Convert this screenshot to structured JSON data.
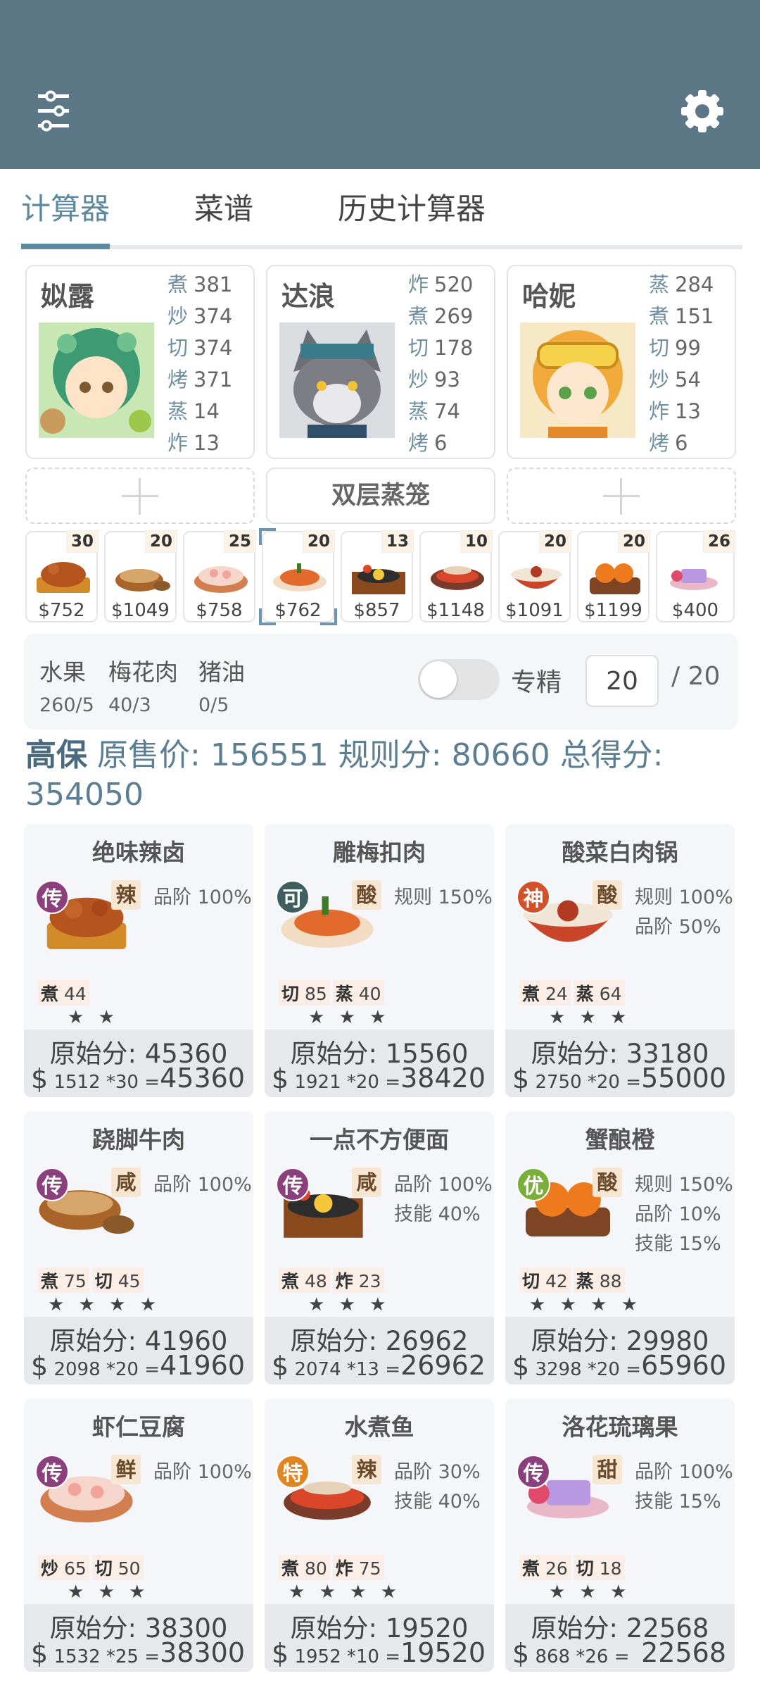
{
  "colors": {
    "header": "#5c7785",
    "accent": "#5c8aa0",
    "badge_chuan": "#8b3f7d",
    "badge_ke": "#3f5f5f",
    "badge_shen": "#d2502a",
    "badge_you": "#7aae3a",
    "badge_te": "#e08520"
  },
  "tabs": [
    "计算器",
    "菜谱",
    "历史计算器"
  ],
  "chefs": [
    {
      "name": "姒露",
      "stats": [
        {
          "k": "煮",
          "v": "381"
        },
        {
          "k": "炒",
          "v": "374"
        },
        {
          "k": "切",
          "v": "374"
        },
        {
          "k": "烤",
          "v": "371"
        },
        {
          "k": "蒸",
          "v": "14"
        },
        {
          "k": "炸",
          "v": "13"
        }
      ]
    },
    {
      "name": "达浪",
      "stats": [
        {
          "k": "炸",
          "v": "520"
        },
        {
          "k": "煮",
          "v": "269"
        },
        {
          "k": "切",
          "v": "178"
        },
        {
          "k": "炒",
          "v": "93"
        },
        {
          "k": "蒸",
          "v": "74"
        },
        {
          "k": "烤",
          "v": "6"
        }
      ]
    },
    {
      "name": "哈妮",
      "stats": [
        {
          "k": "蒸",
          "v": "284"
        },
        {
          "k": "煮",
          "v": "151"
        },
        {
          "k": "切",
          "v": "99"
        },
        {
          "k": "炒",
          "v": "54"
        },
        {
          "k": "炸",
          "v": "13"
        },
        {
          "k": "烤",
          "v": "6"
        }
      ]
    }
  ],
  "equip_slot": "双层蒸笼",
  "dishes": [
    {
      "qty": "30",
      "price": "$752"
    },
    {
      "qty": "20",
      "price": "$1049"
    },
    {
      "qty": "25",
      "price": "$758"
    },
    {
      "qty": "20",
      "price": "$762"
    },
    {
      "qty": "13",
      "price": "$857"
    },
    {
      "qty": "10",
      "price": "$1148"
    },
    {
      "qty": "20",
      "price": "$1091"
    },
    {
      "qty": "20",
      "price": "$1199"
    },
    {
      "qty": "26",
      "price": "$400"
    }
  ],
  "ingredients": [
    {
      "name": "水果",
      "count": "260/5"
    },
    {
      "name": "梅花肉",
      "count": "40/3"
    },
    {
      "name": "猪油",
      "count": "0/5"
    }
  ],
  "specialize": {
    "label": "专精",
    "value": "20",
    "max": "/ 20",
    "on": false
  },
  "summary": {
    "name": "高保",
    "orig_label": "原售价:",
    "orig": "156551",
    "rule_label": "规则分:",
    "rule": "80660",
    "total_label": "总得分:",
    "total": "354050"
  },
  "recipes": [
    {
      "title": "绝味辣卤",
      "badge": "传",
      "flavor": "辣",
      "tags": [
        "品阶 100%"
      ],
      "skills": [
        {
          "k": "煮",
          "v": "44"
        }
      ],
      "stars": "★ ★",
      "orig": "原始分: 45360",
      "price": "1512",
      "mult": "*30 =",
      "total": "45360"
    },
    {
      "title": "雕梅扣肉",
      "badge": "可",
      "flavor": "酸",
      "tags": [
        "规则 150%"
      ],
      "skills": [
        {
          "k": "切",
          "v": "85"
        },
        {
          "k": "蒸",
          "v": "40"
        }
      ],
      "stars": "★ ★ ★",
      "orig": "原始分: 15560",
      "price": "1921",
      "mult": "*20 =",
      "total": "38420"
    },
    {
      "title": "酸菜白肉锅",
      "badge": "神",
      "flavor": "酸",
      "tags": [
        "规则 100%",
        "品阶 50%"
      ],
      "skills": [
        {
          "k": "煮",
          "v": "24"
        },
        {
          "k": "蒸",
          "v": "64"
        }
      ],
      "stars": "★ ★ ★",
      "orig": "原始分: 33180",
      "price": "2750",
      "mult": "*20 =",
      "total": "55000"
    },
    {
      "title": "跷脚牛肉",
      "badge": "传",
      "flavor": "咸",
      "tags": [
        "品阶 100%"
      ],
      "skills": [
        {
          "k": "煮",
          "v": "75"
        },
        {
          "k": "切",
          "v": "45"
        }
      ],
      "stars": "★ ★ ★ ★",
      "orig": "原始分: 41960",
      "price": "2098",
      "mult": "*20 =",
      "total": "41960"
    },
    {
      "title": "一点不方便面",
      "badge": "传",
      "flavor": "咸",
      "tags": [
        "品阶 100%",
        "技能 40%"
      ],
      "skills": [
        {
          "k": "煮",
          "v": "48"
        },
        {
          "k": "炸",
          "v": "23"
        }
      ],
      "stars": "★ ★ ★",
      "orig": "原始分: 26962",
      "price": "2074",
      "mult": "*13 =",
      "total": "26962"
    },
    {
      "title": "蟹酿橙",
      "badge": "优",
      "flavor": "酸",
      "tags": [
        "规则 150%",
        "品阶 10%",
        "技能 15%"
      ],
      "skills": [
        {
          "k": "切",
          "v": "42"
        },
        {
          "k": "蒸",
          "v": "88"
        }
      ],
      "stars": "★ ★ ★ ★",
      "orig": "原始分: 29980",
      "price": "3298",
      "mult": "*20 =",
      "total": "65960"
    },
    {
      "title": "虾仁豆腐",
      "badge": "传",
      "flavor": "鲜",
      "tags": [
        "品阶 100%"
      ],
      "skills": [
        {
          "k": "炒",
          "v": "65"
        },
        {
          "k": "切",
          "v": "50"
        }
      ],
      "stars": "★ ★ ★",
      "orig": "原始分: 38300",
      "price": "1532",
      "mult": "*25 =",
      "total": "38300"
    },
    {
      "title": "水煮鱼",
      "badge": "特",
      "flavor": "辣",
      "tags": [
        "品阶 30%",
        "技能 40%"
      ],
      "skills": [
        {
          "k": "煮",
          "v": "80"
        },
        {
          "k": "炸",
          "v": "75"
        }
      ],
      "stars": "★ ★ ★ ★",
      "orig": "原始分: 19520",
      "price": "1952",
      "mult": "*10 =",
      "total": "19520"
    },
    {
      "title": "洛花琉璃果",
      "badge": "传",
      "flavor": "甜",
      "tags": [
        "品阶 100%",
        "技能 15%"
      ],
      "skills": [
        {
          "k": "煮",
          "v": "26"
        },
        {
          "k": "切",
          "v": "18"
        }
      ],
      "stars": "★ ★ ★",
      "orig": "原始分: 22568",
      "price": "868",
      "mult": "*26 =",
      "total": "22568"
    }
  ]
}
